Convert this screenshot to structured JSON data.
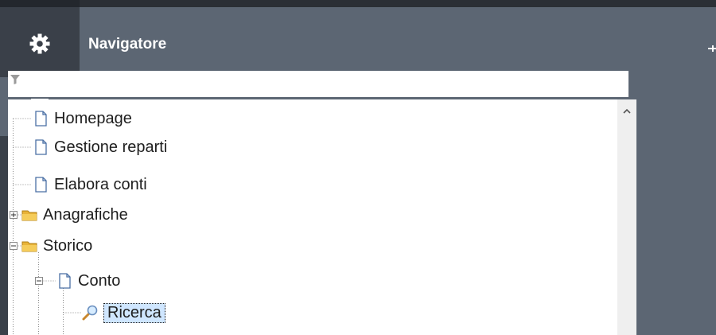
{
  "sidebar": {
    "buttons": [
      {
        "icon": "gear-icon",
        "active": false
      },
      {
        "icon": "monitor-icon",
        "active": true
      },
      {
        "icon": "add-widget-icon",
        "active": false
      }
    ]
  },
  "navigator": {
    "title": "Navigatore",
    "filter": {
      "value": "",
      "placeholder": ""
    },
    "tree": [
      {
        "label": "Homepage",
        "icon": "page-icon"
      },
      {
        "label": "Gestione reparti",
        "icon": "page-icon"
      },
      {
        "label": "Elabora conti",
        "icon": "page-icon"
      },
      {
        "label": "Anagrafiche",
        "icon": "folder-icon",
        "expander": "plus"
      },
      {
        "label": "Storico",
        "icon": "folder-icon",
        "expander": "minus"
      },
      {
        "label": "Conto",
        "icon": "page-icon",
        "expander": "minus"
      },
      {
        "label": "Ricerca",
        "icon": "search-icon",
        "selected": true
      }
    ]
  },
  "colors": {
    "rail": "#3a4049",
    "rail_active": "#5d6774",
    "header": "#5c6673",
    "selection": "#cfe6ff"
  }
}
